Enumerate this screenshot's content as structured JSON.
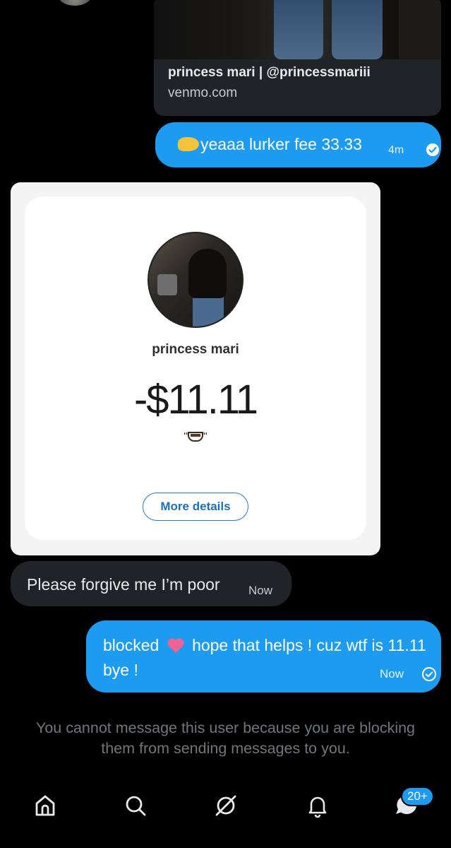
{
  "link_preview": {
    "title": "princess mari | @princessmariii",
    "domain": "venmo.com"
  },
  "messages": {
    "lurker": {
      "text": "yeaaa lurker fee 33.33",
      "time": "4m"
    },
    "forgive": {
      "text": "Please forgive me I’m poor",
      "time": "Now"
    },
    "blocked": {
      "text_before_emoji": "blocked",
      "text_after_emoji": "hope that helps ! cuz wtf is 11.11 bye !",
      "time": "Now"
    }
  },
  "venmo_card": {
    "name": "princess mari",
    "amount": "-$11.11",
    "note_open": "\"",
    "note_close": "\"",
    "more_details_label": "More details"
  },
  "notice": "You cannot message this user because you are blocking them from sending messages to you.",
  "nav": {
    "messages_badge": "20+"
  },
  "colors": {
    "accent": "#1d9bf0",
    "background": "#000000",
    "incoming_bubble": "#202327",
    "venmo_link": "#1f6fb8"
  }
}
